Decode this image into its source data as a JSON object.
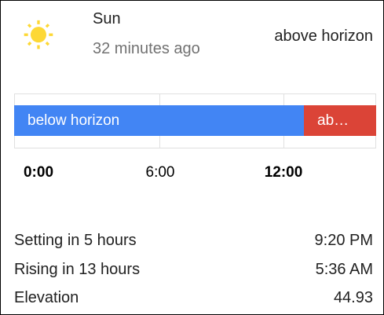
{
  "entity": {
    "name": "Sun",
    "last_changed": "32 minutes ago",
    "state": "above horizon",
    "icon": "sun-icon"
  },
  "colors": {
    "icon": "#fdd835",
    "below": "#4285f4",
    "above": "#db4437",
    "secondary_text": "#727272"
  },
  "timeline": {
    "segments": [
      {
        "label": "below horizon",
        "state": "below",
        "fraction": 0.8
      },
      {
        "label": "ab…",
        "state": "above",
        "fraction": 0.2
      }
    ],
    "ticks": [
      {
        "label": "0:00",
        "bold": true
      },
      {
        "label": "6:00",
        "bold": false
      },
      {
        "label": "12:00",
        "bold": true
      }
    ]
  },
  "attributes": [
    {
      "label": "Setting in 5 hours",
      "value": "9:20 PM"
    },
    {
      "label": "Rising in 13 hours",
      "value": "5:36 AM"
    },
    {
      "label": "Elevation",
      "value": "44.93"
    }
  ]
}
